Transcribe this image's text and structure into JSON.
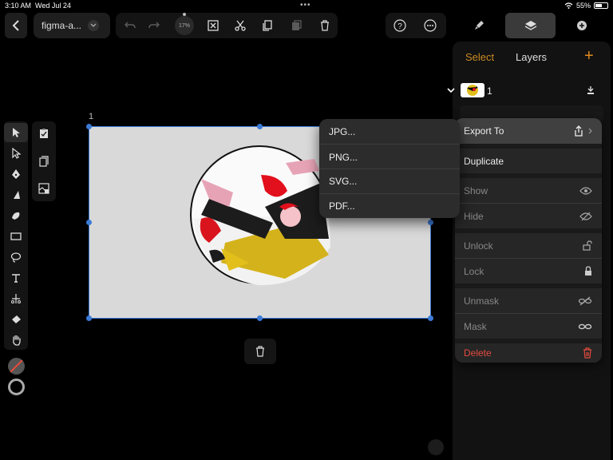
{
  "status": {
    "time": "3:10 AM",
    "date": "Wed Jul 24",
    "battery": "55%",
    "battery_level": 0.55
  },
  "toolbar": {
    "document_name": "figma-a...",
    "zoom": "17%"
  },
  "canvas": {
    "frame_label": "1"
  },
  "panel": {
    "select_label": "Select",
    "title": "Layers",
    "layer_name": "1"
  },
  "context_menu": {
    "items": [
      {
        "label": "Export To"
      },
      {
        "label": "Duplicate"
      },
      {
        "label": "Show"
      },
      {
        "label": "Hide"
      },
      {
        "label": "Unlock"
      },
      {
        "label": "Lock"
      },
      {
        "label": "Unmask"
      },
      {
        "label": "Mask"
      },
      {
        "label": "Delete"
      }
    ]
  },
  "export_menu": {
    "items": [
      {
        "label": "JPG..."
      },
      {
        "label": "PNG..."
      },
      {
        "label": "SVG..."
      },
      {
        "label": "PDF..."
      }
    ]
  },
  "colors": {
    "accent_orange": "#e08a1e",
    "selection_blue": "#3b7bd8",
    "danger_red": "#e34b3e"
  }
}
